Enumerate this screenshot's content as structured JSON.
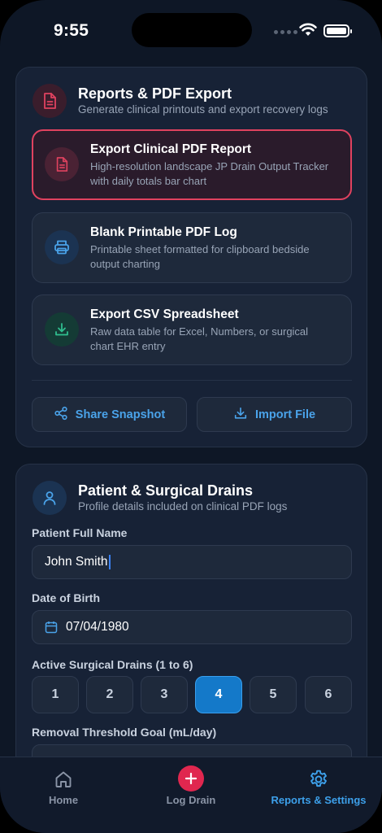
{
  "status_bar": {
    "time": "9:55"
  },
  "export_card": {
    "title": "Reports & PDF Export",
    "subtitle": "Generate clinical printouts and export recovery logs",
    "options": [
      {
        "title": "Export Clinical PDF Report",
        "desc": "High-resolution landscape JP Drain Output Tracker with daily totals bar chart",
        "icon": "document-icon",
        "selected": true
      },
      {
        "title": "Blank Printable PDF Log",
        "desc": "Printable sheet formatted for clipboard bedside output charting",
        "icon": "printer-icon",
        "selected": false
      },
      {
        "title": "Export CSV Spreadsheet",
        "desc": "Raw data table for Excel, Numbers, or surgical chart EHR entry",
        "icon": "download-icon",
        "selected": false
      }
    ],
    "share_label": "Share Snapshot",
    "import_label": "Import File"
  },
  "patient_card": {
    "title": "Patient & Surgical Drains",
    "subtitle": "Profile details included on clinical PDF logs",
    "name_label": "Patient Full Name",
    "name_value": "John Smith",
    "dob_label": "Date of Birth",
    "dob_value": "07/04/1980",
    "drains_label": "Active Surgical Drains (1 to 6)",
    "drain_options": [
      "1",
      "2",
      "3",
      "4",
      "5",
      "6"
    ],
    "drain_selected": "4",
    "threshold_label": "Removal Threshold Goal (mL/day)"
  },
  "tabbar": {
    "tabs": [
      {
        "label": "Home",
        "icon": "home-icon",
        "active": false
      },
      {
        "label": "Log Drain",
        "icon": "plus-icon",
        "active": false
      },
      {
        "label": "Reports & Settings",
        "icon": "gear-icon",
        "active": true
      }
    ]
  },
  "colors": {
    "accent": "#3da0ea",
    "danger": "#e0425f",
    "background": "#0e1726",
    "card": "#172236"
  }
}
